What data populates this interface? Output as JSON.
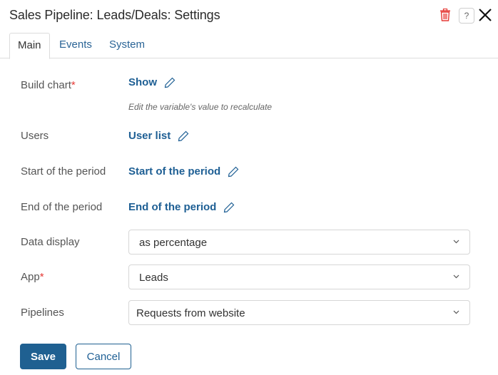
{
  "window": {
    "title": "Sales Pipeline: Leads/Deals: Settings",
    "icons": {
      "delete": "trash-icon",
      "help": "help-icon",
      "close": "close-icon"
    },
    "help_glyph": "?"
  },
  "tabs": [
    {
      "label": "Main",
      "active": true
    },
    {
      "label": "Events",
      "active": false
    },
    {
      "label": "System",
      "active": false
    }
  ],
  "fields": {
    "build_chart": {
      "label": "Build chart",
      "required_mark": "*",
      "value": "Show",
      "hint": "Edit the variable's value to recalculate"
    },
    "users": {
      "label": "Users",
      "value": "User list"
    },
    "start_period": {
      "label": "Start of the period",
      "value": "Start of the period"
    },
    "end_period": {
      "label": "End of the period",
      "value": "End of the period"
    },
    "data_display": {
      "label": "Data display",
      "value": "as percentage"
    },
    "app": {
      "label": "App",
      "required_mark": "*",
      "value": "Leads"
    },
    "pipelines": {
      "label": "Pipelines",
      "value": "Requests from website"
    }
  },
  "buttons": {
    "save": "Save",
    "cancel": "Cancel"
  },
  "colors": {
    "accent": "#1f6091",
    "required": "#e53935",
    "delete_icon": "#e53935"
  }
}
